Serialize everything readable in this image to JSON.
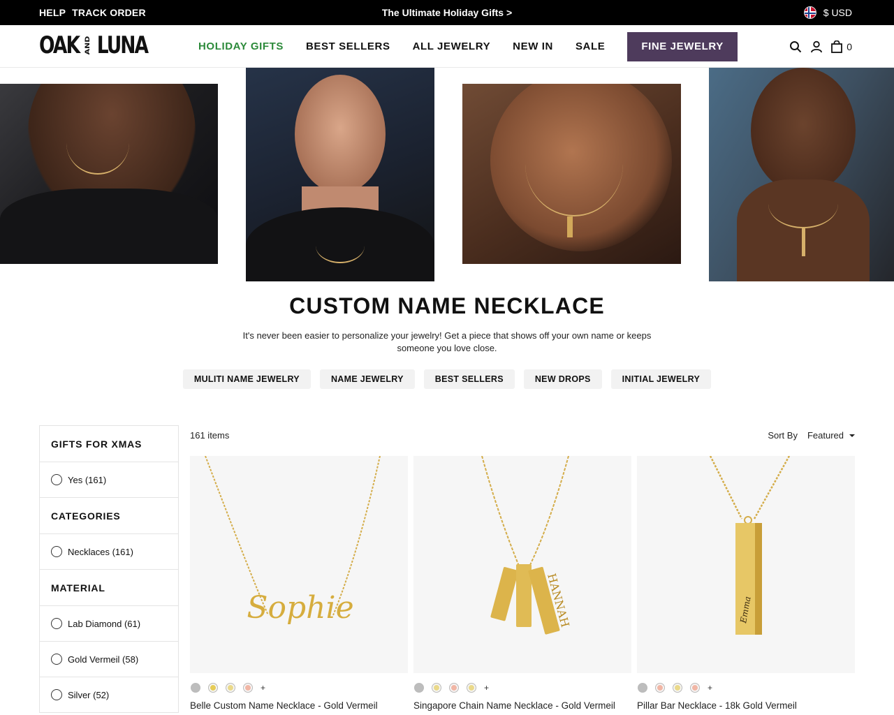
{
  "topbar": {
    "help": "HELP",
    "track": "TRACK ORDER",
    "promo": "The Ultimate Holiday Gifts >",
    "currency": "$ USD"
  },
  "header": {
    "logo_left": "OAK",
    "logo_mid_top": "AND",
    "logo_right": "LUNA",
    "nav": [
      "HOLIDAY GIFTS",
      "BEST SELLERS",
      "ALL JEWELRY",
      "NEW IN",
      "SALE"
    ],
    "fine": "FINE JEWELRY",
    "cart_count": "0",
    "accent_color": "#2c8a3a",
    "fine_bg": "#4e3b5c"
  },
  "page": {
    "title": "CUSTOM NAME NECKLACE",
    "description": "It's never been easier to personalize your jewelry! Get a piece that shows off your own name or keeps someone you love close.",
    "pills": [
      "MULITI NAME JEWELRY",
      "NAME JEWELRY",
      "BEST SELLERS",
      "NEW DROPS",
      "INITIAL JEWELRY"
    ]
  },
  "filters": [
    {
      "heading": "GIFTS FOR XMAS",
      "options": [
        "Yes (161)"
      ]
    },
    {
      "heading": "CATEGORIES",
      "options": [
        "Necklaces (161)"
      ]
    },
    {
      "heading": "MATERIAL",
      "options": [
        "Lab Diamond (61)",
        "Gold Vermeil (58)",
        "Silver (52)"
      ]
    }
  ],
  "listing": {
    "count": "161 items",
    "sort_label": "Sort By",
    "sort_value": "Featured"
  },
  "products": [
    {
      "name": "Belle Custom Name Necklace - Gold Vermeil",
      "swatches": [
        "silver",
        "gold",
        "gold2",
        "rose"
      ],
      "engraving": "Sophie"
    },
    {
      "name": "Singapore Chain Name Necklace - Gold Vermeil",
      "swatches": [
        "silver",
        "gold2",
        "rose",
        "gold2"
      ],
      "engraving": "HANNAH"
    },
    {
      "name": "Pillar Bar Necklace - 18k Gold Vermeil",
      "swatches": [
        "silver",
        "rose",
        "gold2",
        "rose"
      ],
      "engraving": "Emma"
    }
  ]
}
